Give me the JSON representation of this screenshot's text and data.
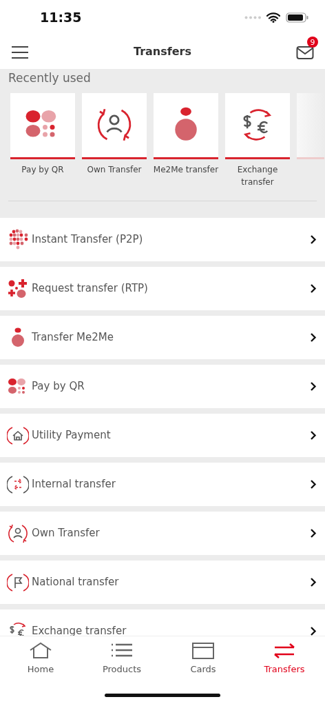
{
  "status_bar": {
    "time": "11:35"
  },
  "header": {
    "title": "Transfers",
    "badge": "9"
  },
  "recently_used": {
    "title": "Recently used",
    "items": [
      {
        "label": "Pay by QR",
        "kind": "qr"
      },
      {
        "label": "Own Transfer",
        "kind": "own"
      },
      {
        "label": "Me2Me transfer",
        "kind": "me2me"
      },
      {
        "label": "Exchange transfer",
        "kind": "exchange"
      }
    ]
  },
  "transfers": [
    {
      "label": "Instant Transfer (P2P)",
      "kind": "p2p"
    },
    {
      "label": "Request transfer (RTP)",
      "kind": "rtp"
    },
    {
      "label": "Transfer Me2Me",
      "kind": "me2me"
    },
    {
      "label": "Pay by QR",
      "kind": "qr"
    },
    {
      "label": "Utility Payment",
      "kind": "utility"
    },
    {
      "label": "Internal transfer",
      "kind": "internal"
    },
    {
      "label": "Own Transfer",
      "kind": "own"
    },
    {
      "label": "National transfer",
      "kind": "national"
    },
    {
      "label": "Exchange transfer",
      "kind": "exchange"
    }
  ],
  "tab_bar": [
    {
      "label": "Home",
      "kind": "home",
      "selected": false
    },
    {
      "label": "Products",
      "kind": "list",
      "selected": false
    },
    {
      "label": "Cards",
      "kind": "card",
      "selected": false
    },
    {
      "label": "Transfers",
      "kind": "transfer",
      "selected": true
    }
  ]
}
